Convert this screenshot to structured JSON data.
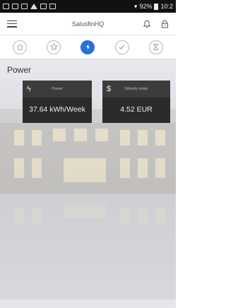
{
  "status_bar": {
    "signal": "92%",
    "time": "10:2"
  },
  "app_bar": {
    "title": "SalusfinHQ"
  },
  "tabs": [
    {
      "icon": "home-icon",
      "active": false
    },
    {
      "icon": "star-icon",
      "active": false
    },
    {
      "icon": "lightning-icon",
      "active": true
    },
    {
      "icon": "checkmark-icon",
      "active": false
    },
    {
      "icon": "hourglass-icon",
      "active": false
    }
  ],
  "page": {
    "title": "Power"
  },
  "cards": {
    "power": {
      "label": "Power",
      "value": "37.64 kWh/Week",
      "icon": "lightning-icon"
    },
    "weekly": {
      "label": "Weekly totals",
      "value": "4.52 EUR",
      "icon": "dollar-icon"
    }
  },
  "colors": {
    "accent": "#2a6fd8",
    "card_bg": "#2b2b2b",
    "card_header": "#3c3c3c"
  }
}
